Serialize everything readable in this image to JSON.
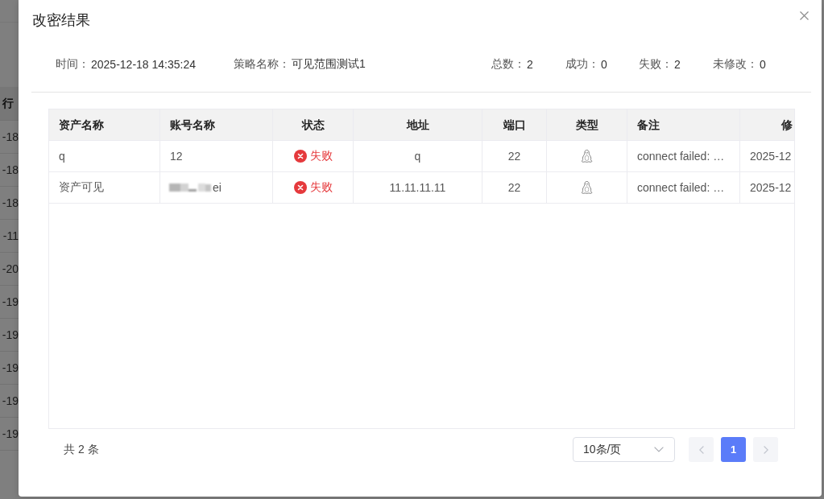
{
  "background_table": {
    "header": "行",
    "rows": [
      "-18",
      "-18",
      "-18",
      "-11",
      "-20",
      "-19",
      "-19",
      "-19",
      "-19",
      "-19"
    ]
  },
  "dialog": {
    "title": "改密结果",
    "summary": [
      {
        "label": "时间：",
        "value": "2025-12-18 14:35:24"
      },
      {
        "label": "策略名称：",
        "value": "可见范围测试1"
      }
    ],
    "counts": [
      {
        "label": "总数：",
        "value": "2"
      },
      {
        "label": "成功：",
        "value": "0"
      },
      {
        "label": "失败：",
        "value": "2"
      },
      {
        "label": "未修改：",
        "value": "0"
      }
    ],
    "table": {
      "columns": [
        "资产名称",
        "账号名称",
        "状态",
        "地址",
        "端口",
        "类型",
        "备注",
        "修"
      ],
      "rows": [
        {
          "asset": "q",
          "account": {
            "text": "12",
            "redacted": false
          },
          "status": {
            "kind": "failed",
            "label": "失败"
          },
          "address": "q",
          "port": "22",
          "type": {
            "kind": "linux"
          },
          "note": "connect failed: …",
          "modified": "2025-12"
        },
        {
          "asset": "资产可见",
          "account": {
            "text": "ei",
            "redacted": true
          },
          "status": {
            "kind": "failed",
            "label": "失败"
          },
          "address": "11.11.11.11",
          "port": "22",
          "type": {
            "kind": "linux"
          },
          "note": "connect failed: …",
          "modified": "2025-12"
        }
      ]
    },
    "pagination": {
      "total": "共 2 条",
      "page_size": "10条/页",
      "prev": {
        "disabled": true
      },
      "pages": [
        {
          "label": "1",
          "selected": true
        }
      ],
      "next": {
        "disabled": true
      }
    }
  }
}
